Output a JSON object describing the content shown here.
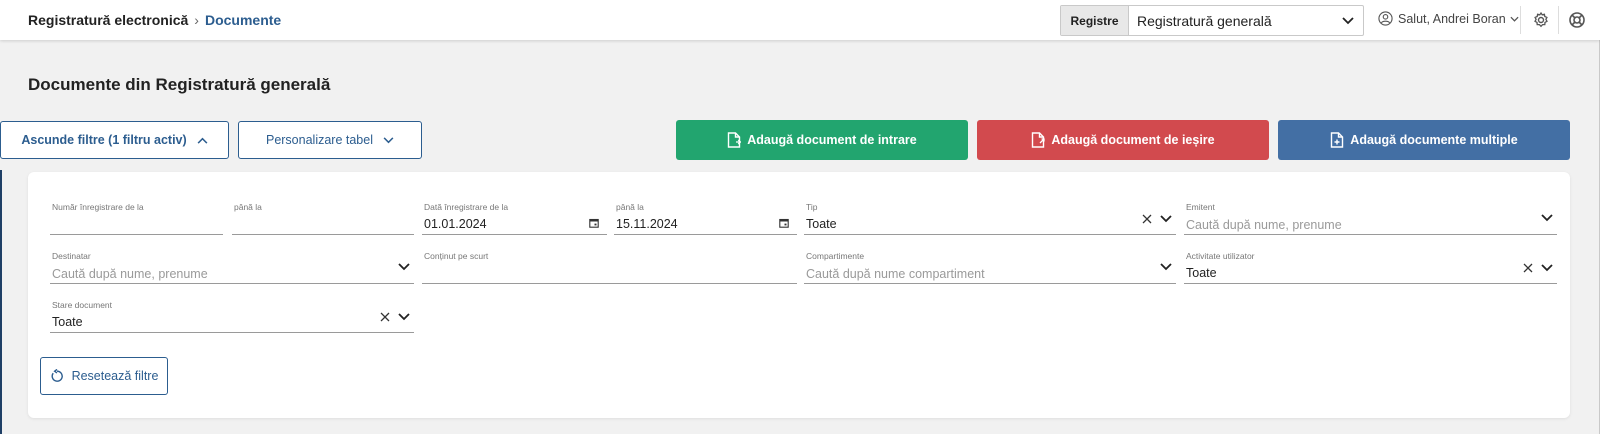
{
  "breadcrumb": {
    "home": "Registratură electronică",
    "separator": "›",
    "current": "Documente"
  },
  "registry_select": {
    "label": "Registre",
    "value": "Registratură generală"
  },
  "user": {
    "greeting": "Salut, Andrei Boran"
  },
  "page": {
    "title": "Documente din Registratură generală"
  },
  "actions": {
    "toggle_filters": "Ascunde filtre (1 filtru activ)",
    "customize_table": "Personalizare tabel",
    "add_incoming": "Adaugă document de intrare",
    "add_outgoing": "Adaugă document de ieșire",
    "add_multiple": "Adaugă documente multiple"
  },
  "filters": {
    "reg_number_from": {
      "label": "Număr înregistrare de la",
      "value": ""
    },
    "reg_number_to": {
      "label": "până la",
      "value": ""
    },
    "reg_date_from": {
      "label": "Dată înregistrare de la",
      "value": "01.01.2024"
    },
    "reg_date_to": {
      "label": "până la",
      "value": "15.11.2024"
    },
    "type": {
      "label": "Tip",
      "value": "Toate"
    },
    "issuer": {
      "label": "Emitent",
      "placeholder": "Caută după nume, prenume"
    },
    "recipient": {
      "label": "Destinatar",
      "placeholder": "Caută după nume, prenume"
    },
    "summary": {
      "label": "Conținut pe scurt",
      "value": ""
    },
    "departments": {
      "label": "Compartimente",
      "placeholder": "Caută după nume compartiment"
    },
    "user_activity": {
      "label": "Activitate utilizator",
      "value": "Toate"
    },
    "document_status": {
      "label": "Stare document",
      "value": "Toate"
    },
    "reset": "Resetează filtre"
  },
  "colors": {
    "primary": "#2c5d8f",
    "green": "#22a56f",
    "red": "#d24a4e",
    "blue": "#436fa4"
  }
}
